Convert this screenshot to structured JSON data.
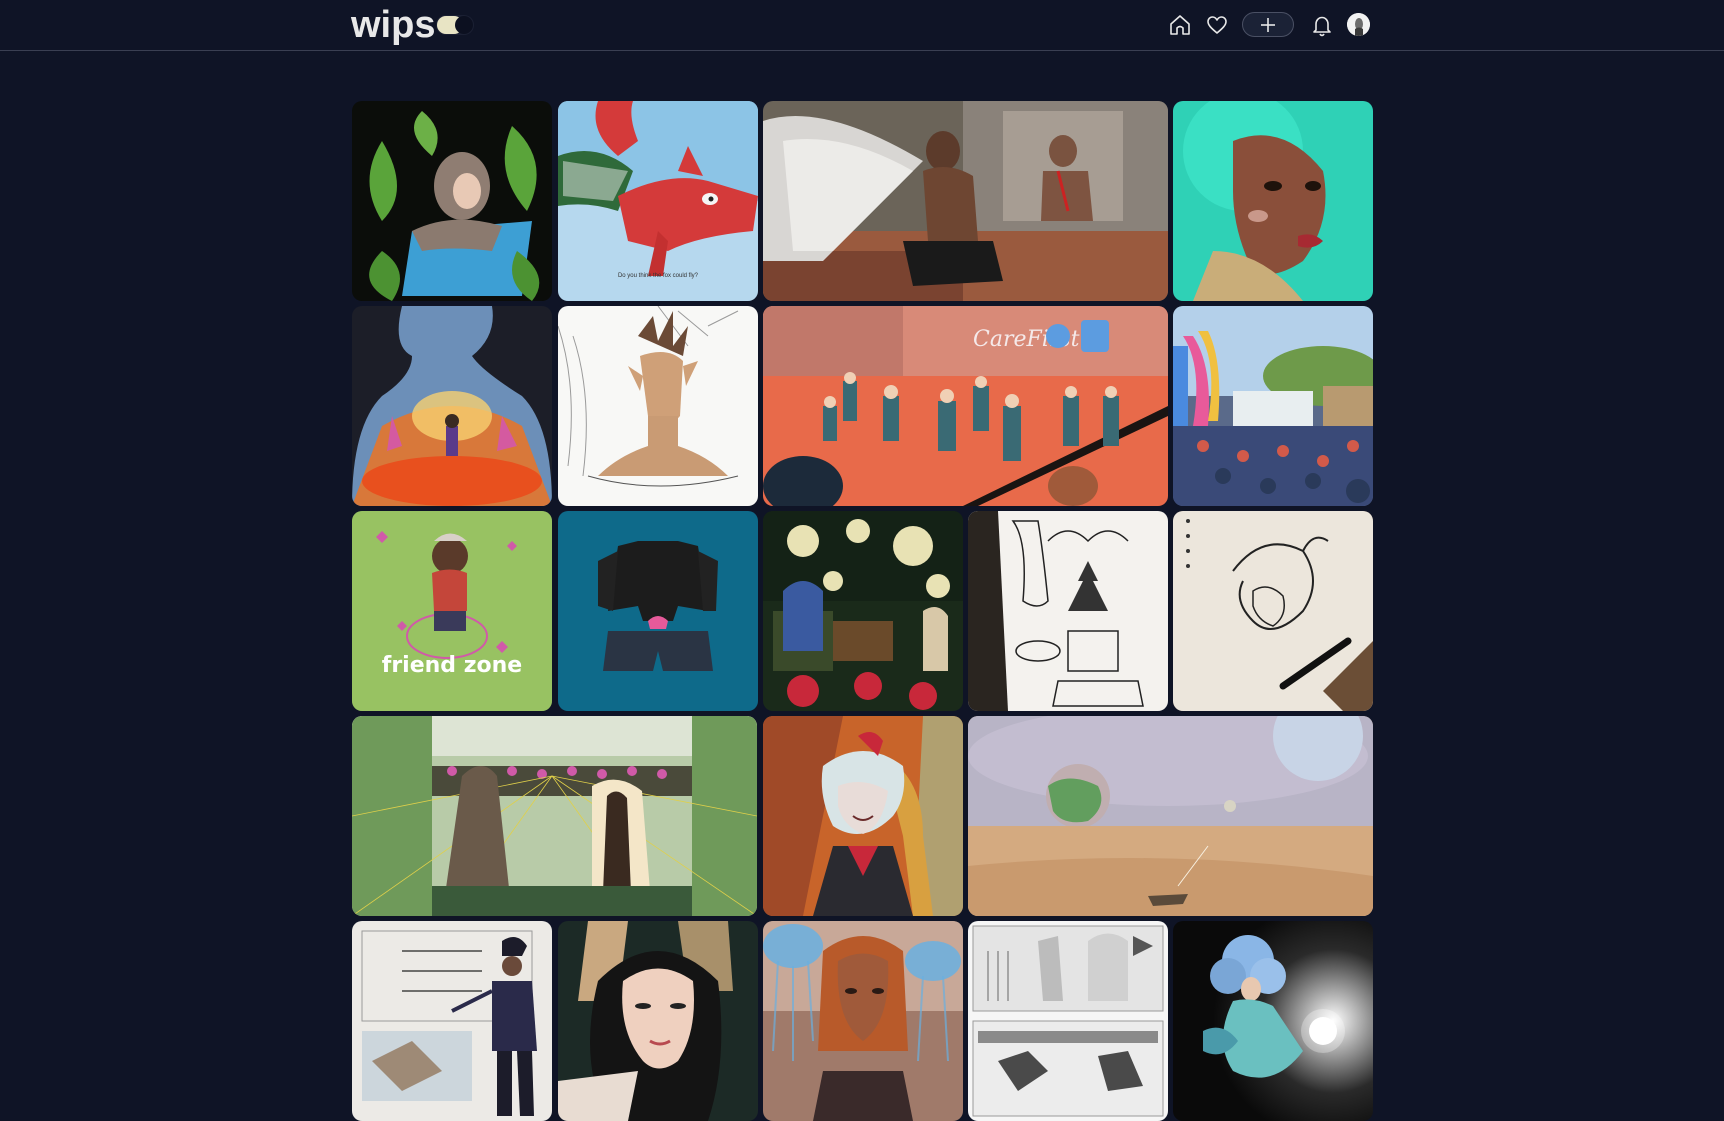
{
  "app": {
    "logo_text": "wips",
    "colors": {
      "background": "#0f1426",
      "accent_toggle": "#e8e4c4",
      "icon_stroke": "#e8e8e8"
    }
  },
  "header": {
    "icons": [
      "home-icon",
      "heart-icon",
      "plus-icon",
      "bell-icon",
      "avatar"
    ]
  },
  "gallery": {
    "tiles": [
      {
        "name": "artwork-girl-with-leaves"
      },
      {
        "name": "artwork-red-fox-flying",
        "caption": "Do you think the fox could fly?"
      },
      {
        "name": "artwork-winged-man-bathroom"
      },
      {
        "name": "artwork-woman-teal-hair"
      },
      {
        "name": "artwork-silhouette-fire"
      },
      {
        "name": "artwork-sketch-elf-man"
      },
      {
        "name": "artwork-carefirst-dance-hall"
      },
      {
        "name": "artwork-outdoor-crowd"
      },
      {
        "name": "artwork-friend-zone",
        "caption": "friend zone"
      },
      {
        "name": "artwork-jacket-shorts"
      },
      {
        "name": "artwork-lantern-market"
      },
      {
        "name": "artwork-ink-sketch-tree"
      },
      {
        "name": "artwork-dragon-sketchbook"
      },
      {
        "name": "artwork-greenhouse-perspective"
      },
      {
        "name": "artwork-white-hair-laughing"
      },
      {
        "name": "artwork-desert-planets"
      },
      {
        "name": "artwork-character-sheet"
      },
      {
        "name": "artwork-woman-portrait"
      },
      {
        "name": "artwork-jellyfish-woman"
      },
      {
        "name": "artwork-storyboard-sketch"
      },
      {
        "name": "artwork-blue-hair-fairy"
      }
    ]
  }
}
